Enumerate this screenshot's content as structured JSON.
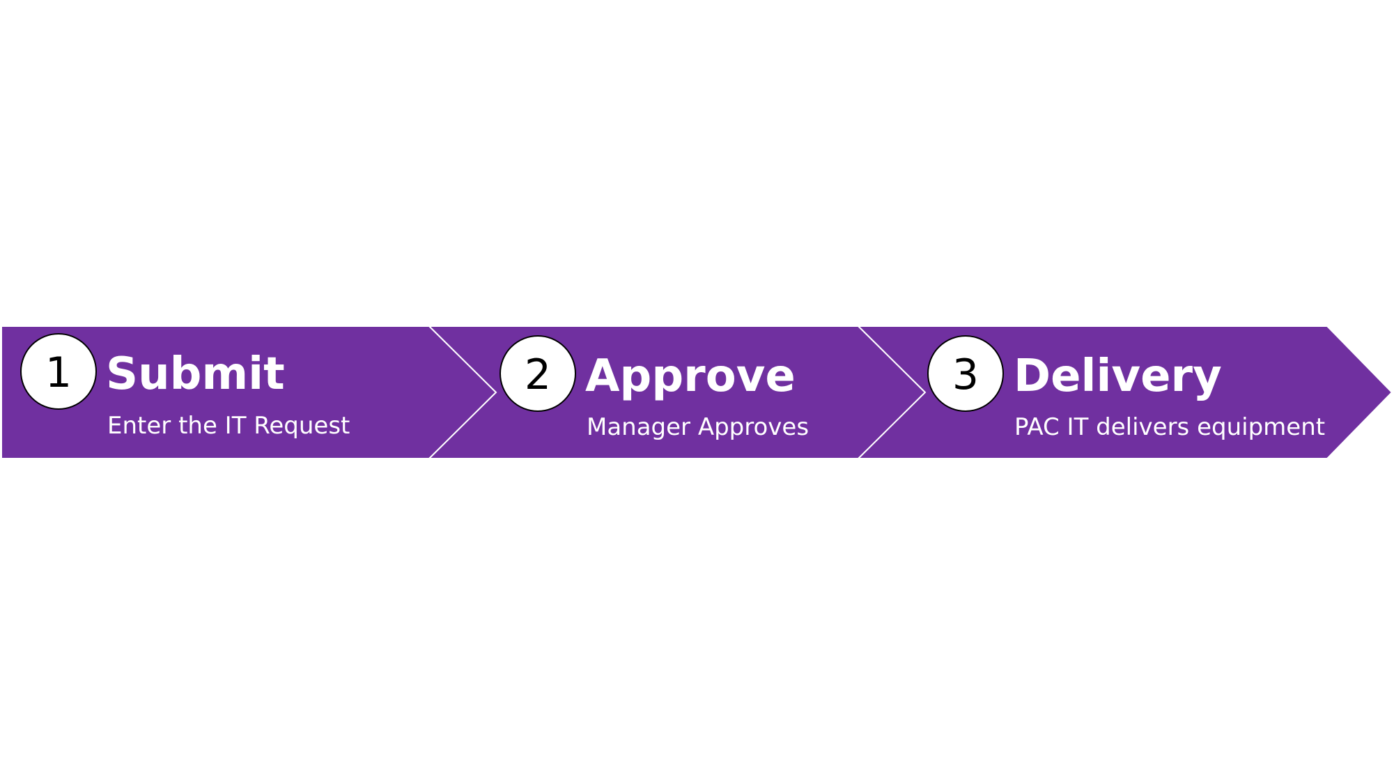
{
  "colors": {
    "chevron_fill": "#7030a0",
    "chevron_border": "#ffffff",
    "circle_fill": "#ffffff",
    "circle_border": "#000000",
    "number_text": "#000000",
    "label_text": "#ffffff"
  },
  "steps": [
    {
      "number": "1",
      "title": "Submit",
      "description": "Enter the IT Request"
    },
    {
      "number": "2",
      "title": "Approve",
      "description": "Manager Approves"
    },
    {
      "number": "3",
      "title": "Delivery",
      "description": "PAC IT delivers equipment"
    }
  ]
}
